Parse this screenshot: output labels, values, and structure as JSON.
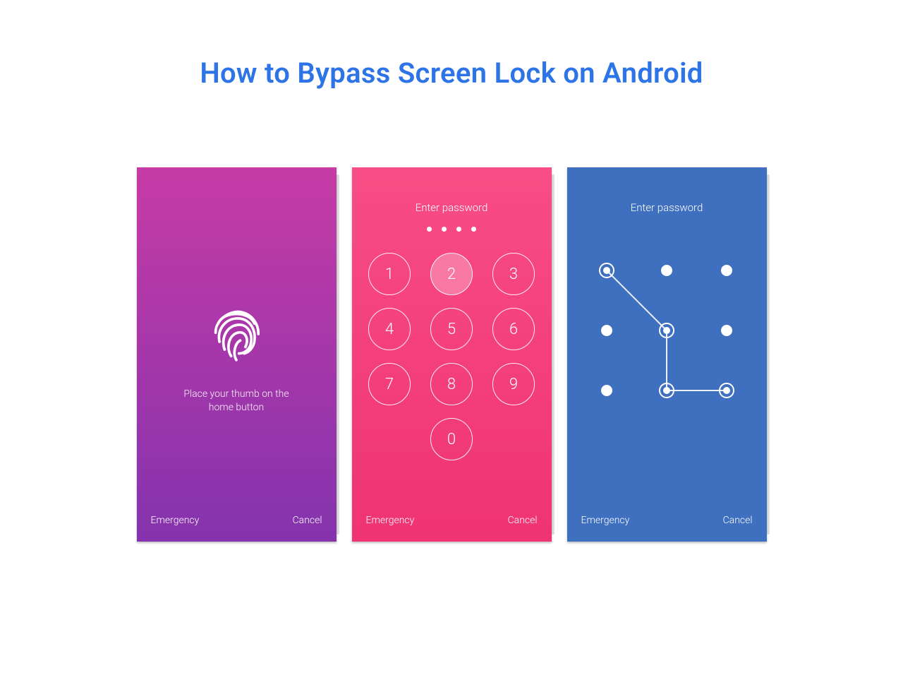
{
  "title": "How to Bypass Screen Lock on Android",
  "colors": {
    "title": "#2d74e6",
    "fingerprint_bg_from": "#c63ba6",
    "fingerprint_bg_to": "#8433ad",
    "pin_bg_from": "#f84d86",
    "pin_bg_to": "#ef3373",
    "pattern_bg": "#3f6fbf"
  },
  "fingerprint": {
    "icon": "fingerprint-icon",
    "hint_line1": "Place your thumb on the",
    "hint_line2": "home button",
    "emergency": "Emergency",
    "cancel": "Cancel"
  },
  "pin": {
    "label": "Enter password",
    "entered_count": 4,
    "keys": [
      "1",
      "2",
      "3",
      "4",
      "5",
      "6",
      "7",
      "8",
      "9",
      "0"
    ],
    "active_key": "2",
    "emergency": "Emergency",
    "cancel": "Cancel"
  },
  "pattern": {
    "label": "Enter password",
    "grid": 3,
    "selected_nodes": [
      1,
      5,
      8,
      9
    ],
    "emergency": "Emergency",
    "cancel": "Cancel"
  }
}
